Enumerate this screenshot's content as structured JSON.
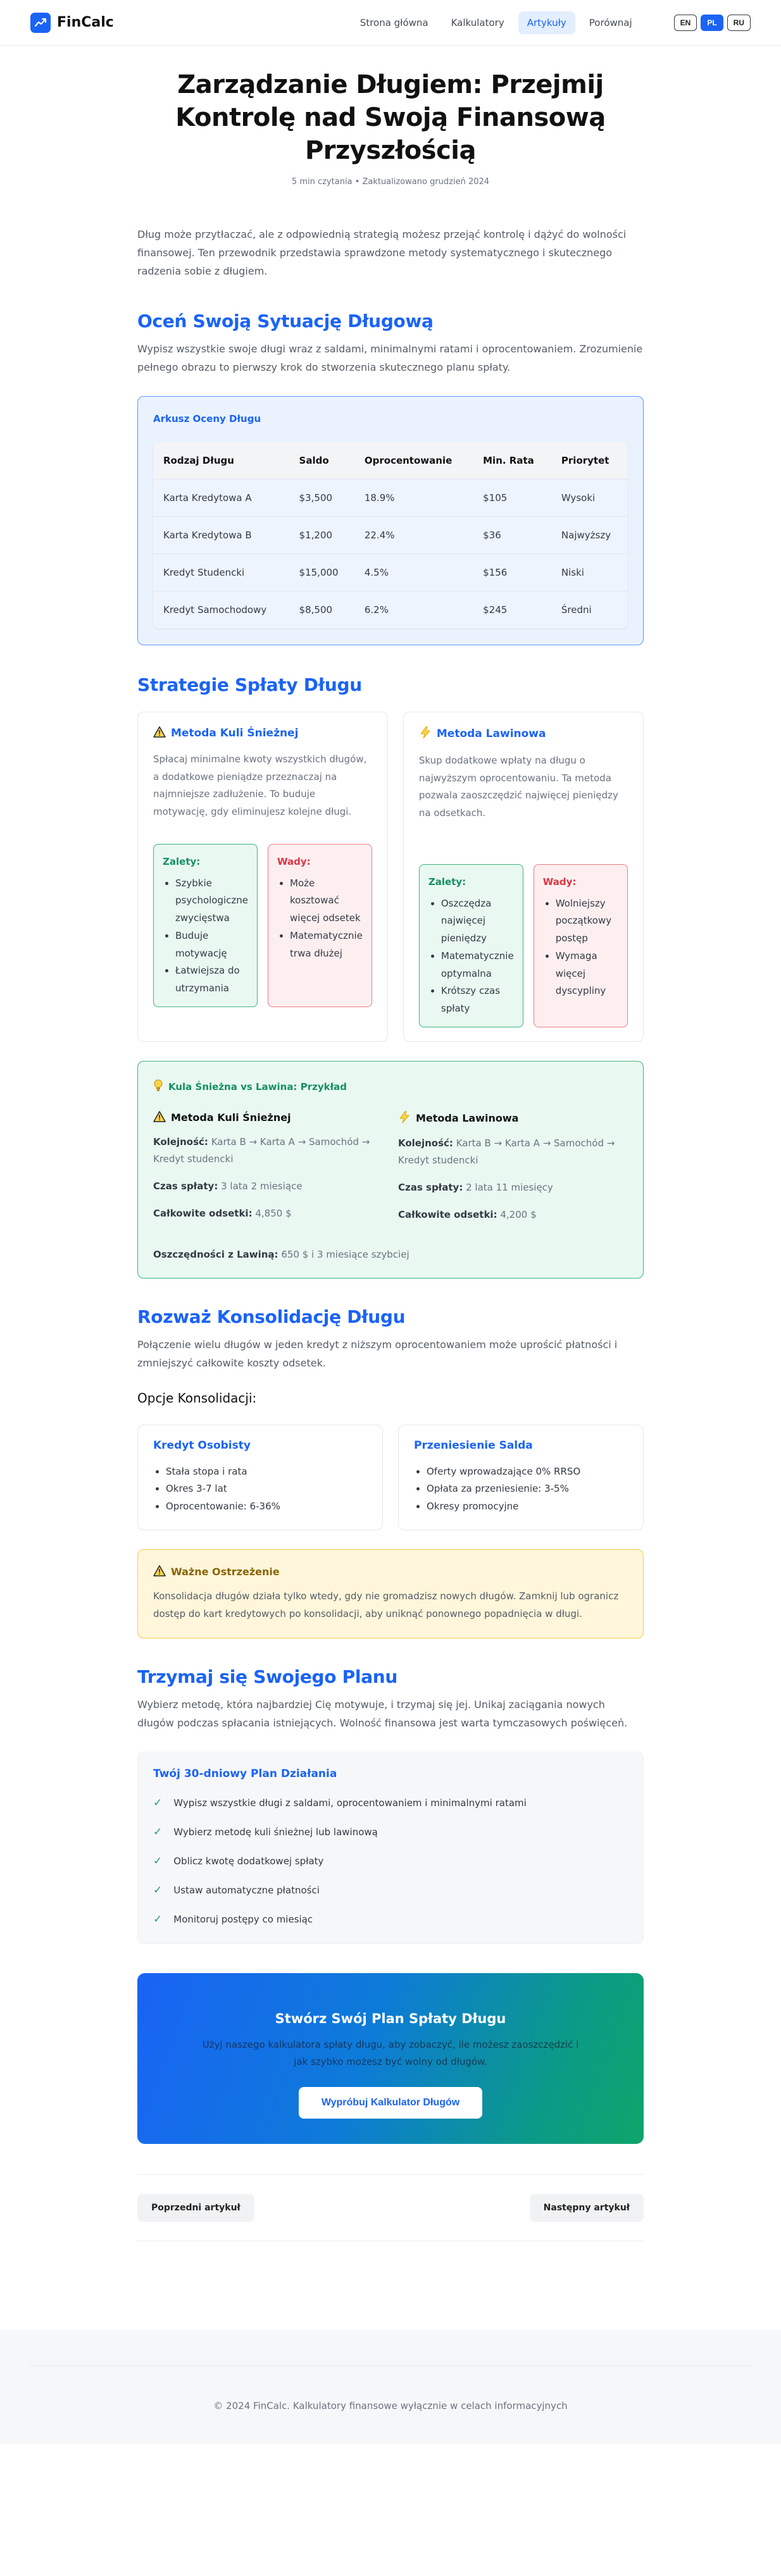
{
  "brand": {
    "name": "FinCalc"
  },
  "nav": {
    "items": [
      "Strona główna",
      "Kalkulatory",
      "Artykuły",
      "Porównaj"
    ],
    "active": "Artykuły"
  },
  "langs": [
    "EN",
    "PL",
    "RU"
  ],
  "active_lang": "PL",
  "hero": {
    "title": "Zarządzanie Długiem: Przejmij Kontrolę nad Swoją Finansową Przyszłością",
    "meta": "5 min czytania • Zaktualizowano grudzień 2024"
  },
  "lead": "Dług może przytłaczać, ale z odpowiednią strategią możesz przejąć kontrolę i dążyć do wolności finansowej. Ten przewodnik przedstawia sprawdzone metody systematycznego i skutecznego radzenia sobie z długiem.",
  "assess": {
    "heading": "Oceń Swoją Sytuację Długową",
    "text": "Wypisz wszystkie swoje długi wraz z saldami, minimalnymi ratami i oprocentowaniem. Zrozumienie pełnego obrazu to pierwszy krok do stworzenia skutecznego planu spłaty.",
    "card_title": "Arkusz Oceny Długu",
    "columns": [
      "Rodzaj Długu",
      "Saldo",
      "Oprocentowanie",
      "Min. Rata",
      "Priorytet"
    ],
    "rows": [
      [
        "Karta Kredytowa A",
        "$3,500",
        "18.9%",
        "$105",
        "Wysoki"
      ],
      [
        "Karta Kredytowa B",
        "$1,200",
        "22.4%",
        "$36",
        "Najwyższy"
      ],
      [
        "Kredyt Studencki",
        "$15,000",
        "4.5%",
        "$156",
        "Niski"
      ],
      [
        "Kredyt Samochodowy",
        "$8,500",
        "6.2%",
        "$245",
        "Średni"
      ]
    ]
  },
  "strategies": {
    "heading": "Strategie Spłaty Długu",
    "snowball": {
      "title": "Metoda Kuli Śnieżnej",
      "desc": "Spłacaj minimalne kwoty wszystkich długów, a dodatkowe pieniądze przeznaczaj na najmniejsze zadłużenie. To buduje motywację, gdy eliminujesz kolejne długi.",
      "pros_title": "Zalety:",
      "pros": [
        "Szybkie psychologiczne zwycięstwa",
        "Buduje motywację",
        "Łatwiejsza do utrzymania"
      ],
      "cons_title": "Wady:",
      "cons": [
        "Może kosztować więcej odsetek",
        "Matematycznie trwa dłużej"
      ]
    },
    "avalanche": {
      "title": "Metoda Lawinowa",
      "desc": "Skup dodatkowe wpłaty na długu o najwyższym oprocentowaniu. Ta metoda pozwala zaoszczędzić najwięcej pieniędzy na odsetkach.",
      "pros_title": "Zalety:",
      "pros": [
        "Oszczędza najwięcej pieniędzy",
        "Matematycznie optymalna",
        "Krótszy czas spłaty"
      ],
      "cons_title": "Wady:",
      "cons": [
        "Wolniejszy początkowy postęp",
        "Wymaga więcej dyscypliny"
      ]
    }
  },
  "example": {
    "title": "Kula Śnieżna vs Lawina: Przykład",
    "snowball": {
      "title": "Metoda Kuli Śnieżnej",
      "order_label": "Kolejność:",
      "order": "Karta B → Karta A → Samochód → Kredyt studencki",
      "time_label": "Czas spłaty:",
      "time": "3 lata 2 miesiące",
      "interest_label": "Całkowite odsetki:",
      "interest": "4,850 $"
    },
    "avalanche": {
      "title": "Metoda Lawinowa",
      "order_label": "Kolejność:",
      "order": "Karta B → Karta A → Samochód → Kredyt studencki",
      "time_label": "Czas spłaty:",
      "time": "2 lata 11 miesięcy",
      "interest_label": "Całkowite odsetki:",
      "interest": "4,200 $"
    },
    "savings_label": "Oszczędności z Lawiną:",
    "savings": "650 $ i 3 miesiące szybciej"
  },
  "consolidation": {
    "heading": "Rozważ Konsolidację Długu",
    "text": "Połączenie wielu długów w jeden kredyt z niższym oprocentowaniem może uprościć płatności i zmniejszyć całkowite koszty odsetek.",
    "options_title": "Opcje Konsolidacji:",
    "personal_loan": {
      "title": "Kredyt Osobisty",
      "items": [
        "Stała stopa i rata",
        "Okres 3-7 lat",
        "Oprocentowanie: 6-36%"
      ]
    },
    "balance_transfer": {
      "title": "Przeniesienie Salda",
      "items": [
        "Oferty wprowadzające 0% RRSO",
        "Opłata za przeniesienie: 3-5%",
        "Okresy promocyjne"
      ]
    },
    "warning_title": "Ważne Ostrzeżenie",
    "warning_text": "Konsolidacja długów działa tylko wtedy, gdy nie gromadzisz nowych długów. Zamknij lub ogranicz dostęp do kart kredytowych po konsolidacji, aby uniknąć ponownego popadnięcia w długi."
  },
  "plan": {
    "heading": "Trzymaj się Swojego Planu",
    "text": "Wybierz metodę, która najbardziej Cię motywuje, i trzymaj się jej. Unikaj zaciągania nowych długów podczas spłacania istniejących. Wolność finansowa jest warta tymczasowych poświęceń.",
    "card_title": "Twój 30-dniowy Plan Działania",
    "items": [
      "Wypisz wszystkie długi z saldami, oprocentowaniem i minimalnymi ratami",
      "Wybierz metodę kuli śnieżnej lub lawinową",
      "Oblicz kwotę dodatkowej spłaty",
      "Ustaw automatyczne płatności",
      "Monitoruj postępy co miesiąc"
    ]
  },
  "cta": {
    "title": "Stwórz Swój Plan Spłaty Długu",
    "text": "Użyj naszego kalkulatora spłaty długu, aby zobaczyć, ile możesz zaoszczędzić i jak szybko możesz być wolny od długów.",
    "button": "Wypróbuj Kalkulator Długów"
  },
  "pager": {
    "prev": "Poprzedni artykuł",
    "next": "Następny artykuł"
  },
  "footer": {
    "text": "© 2024 FinCalc. Kalkulatory finansowe wyłącznie w celach informacyjnych"
  },
  "colors": {
    "accent": "#1a63f5",
    "success": "#159063",
    "danger": "#dc3545",
    "warning": "#8a6400"
  },
  "icons": {
    "brand": "trend-chart-icon",
    "snowball": "warning-triangle-icon",
    "avalanche": "lightning-icon",
    "example": "lightbulb-icon",
    "warning": "warning-triangle-icon",
    "check": "check-icon"
  }
}
